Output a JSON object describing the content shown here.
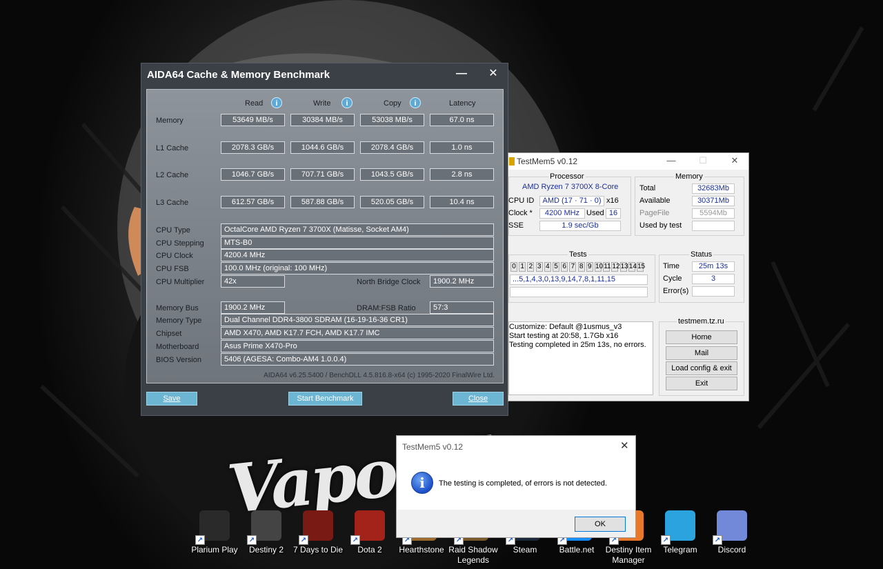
{
  "desktop": {
    "wallpaper_text": "VaporFly",
    "icons": [
      {
        "label": "Plarium Play",
        "color": "#2a2a2a"
      },
      {
        "label": "Destiny 2",
        "color": "#444444"
      },
      {
        "label": "7 Days to Die",
        "color": "#7a1a14"
      },
      {
        "label": "Dota 2",
        "color": "#a3231b"
      },
      {
        "label": "Hearthstone",
        "color": "#9b6a2c"
      },
      {
        "label": "Raid Shadow Legends",
        "color": "#7a5a2a"
      },
      {
        "label": "Steam",
        "color": "#1b2838"
      },
      {
        "label": "Battle.net",
        "color": "#148eff"
      },
      {
        "label": "Destiny Item Manager",
        "color": "#e8782a"
      },
      {
        "label": "Telegram",
        "color": "#2aa3de"
      },
      {
        "label": "Discord",
        "color": "#7289da"
      }
    ]
  },
  "aida": {
    "title": "AIDA64 Cache & Memory Benchmark",
    "headers": {
      "read": "Read",
      "write": "Write",
      "copy": "Copy",
      "latency": "Latency"
    },
    "rows": [
      {
        "label": "Memory",
        "read": "53649 MB/s",
        "write": "30384 MB/s",
        "copy": "53038 MB/s",
        "latency": "67.0 ns"
      },
      {
        "label": "L1 Cache",
        "read": "2078.3 GB/s",
        "write": "1044.6 GB/s",
        "copy": "2078.4 GB/s",
        "latency": "1.0 ns"
      },
      {
        "label": "L2 Cache",
        "read": "1046.7 GB/s",
        "write": "707.71 GB/s",
        "copy": "1043.5 GB/s",
        "latency": "2.8 ns"
      },
      {
        "label": "L3 Cache",
        "read": "612.57 GB/s",
        "write": "587.88 GB/s",
        "copy": "520.05 GB/s",
        "latency": "10.4 ns"
      }
    ],
    "cpu_type_label": "CPU Type",
    "cpu_type": "OctalCore AMD Ryzen 7 3700X  (Matisse, Socket AM4)",
    "cpu_stepping_label": "CPU Stepping",
    "cpu_stepping": "MTS-B0",
    "cpu_clock_label": "CPU Clock",
    "cpu_clock": "4200.4 MHz",
    "cpu_fsb_label": "CPU FSB",
    "cpu_fsb": "100.0 MHz  (original: 100 MHz)",
    "cpu_mult_label": "CPU Multiplier",
    "cpu_mult": "42x",
    "nb_clock_label": "North Bridge Clock",
    "nb_clock": "1900.2 MHz",
    "mem_bus_label": "Memory Bus",
    "mem_bus": "1900.2 MHz",
    "dram_ratio_label": "DRAM:FSB Ratio",
    "dram_ratio": "57:3",
    "mem_type_label": "Memory Type",
    "mem_type": "Dual Channel DDR4-3800 SDRAM  (16-19-16-36 CR1)",
    "chipset_label": "Chipset",
    "chipset": "AMD X470, AMD K17.7 FCH, AMD K17.7 IMC",
    "motherboard_label": "Motherboard",
    "motherboard": "Asus Prime X470-Pro",
    "bios_label": "BIOS Version",
    "bios": "5406  (AGESA: Combo-AM4 1.0.0.4)",
    "footer": "AIDA64 v6.25.5400 / BenchDLL 4.5.816.8-x64  (c) 1995-2020 FinalWire Ltd.",
    "save_btn": "Save",
    "start_btn": "Start Benchmark",
    "close_btn": "Close"
  },
  "testmem": {
    "title": "TestMem5 v0.12",
    "processor_group": "Processor",
    "processor_name": "AMD Ryzen 7 3700X 8-Core",
    "cpuid_label": "CPU ID",
    "cpuid_val": "AMD  (17 · 71 · 0)",
    "cpuid_threads": "x16",
    "clock_label": "Clock *",
    "clock_val": "4200 MHz",
    "used_label": "Used",
    "used_val": "16",
    "sse_label": "SSE",
    "sse_val": "1.9 sec/Gb",
    "memory_group": "Memory",
    "total_label": "Total",
    "total_val": "32683Mb",
    "avail_label": "Available",
    "avail_val": "30371Mb",
    "pagefile_label": "PageFile",
    "pagefile_val": "5594Mb",
    "usedtest_label": "Used by test",
    "usedtest_val": "",
    "tests_group": "Tests",
    "test_cells": [
      "0",
      "1",
      "2",
      "3",
      "4",
      "5",
      "6",
      "7",
      "8",
      "9",
      "10",
      "11",
      "12",
      "13",
      "14",
      "15"
    ],
    "test_sequence": "...5,1,4,3,0,13,9,14,7,8,1,11,15",
    "status_group": "Status",
    "time_label": "Time",
    "time_val": "25m 13s",
    "cycle_label": "Cycle",
    "cycle_val": "3",
    "errors_label": "Error(s)",
    "errors_val": "",
    "log": [
      "Customize: Default @1usmus_v3",
      "Start testing at 20:58, 1.7Gb x16",
      "Testing completed in 25m 13s, no errors."
    ],
    "site_group": "testmem.tz.ru",
    "btn_home": "Home",
    "btn_mail": "Mail",
    "btn_load": "Load config & exit",
    "btn_exit": "Exit"
  },
  "dialog": {
    "title": "TestMem5 v0.12",
    "message": "The testing is completed, of errors is not detected.",
    "ok": "OK"
  }
}
